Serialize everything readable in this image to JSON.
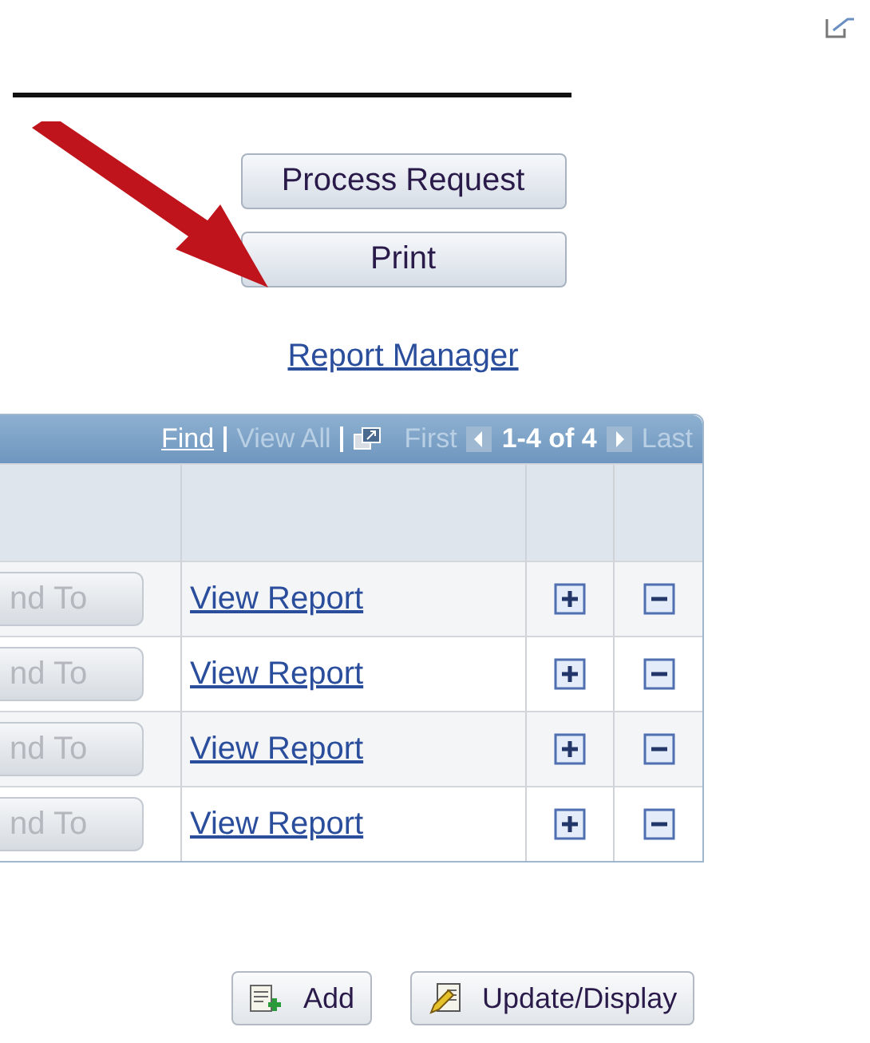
{
  "actions": [
    {
      "label": "Process Request"
    },
    {
      "label": "Print"
    }
  ],
  "report_manager_link": "Report Manager",
  "grid": {
    "navigation": {
      "find": "Find",
      "view_all": "View All",
      "first": "First",
      "range": "1-4 of 4",
      "last": "Last"
    },
    "rows": [
      {
        "send_button": "nd To",
        "link": "View Report"
      },
      {
        "send_button": "nd To",
        "link": "View Report"
      },
      {
        "send_button": "nd To",
        "link": "View Report"
      },
      {
        "send_button": "nd To",
        "link": "View Report"
      }
    ]
  },
  "bottom_buttons": [
    {
      "kind": "add",
      "label": "Add"
    },
    {
      "kind": "update",
      "label": "Update/Display"
    }
  ]
}
